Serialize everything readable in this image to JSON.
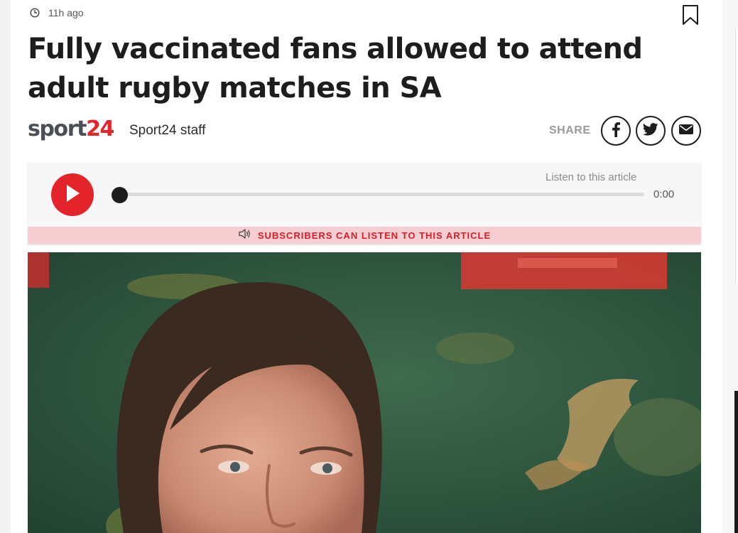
{
  "article": {
    "timestamp": "11h ago",
    "headline": "Fully vaccinated fans allowed to attend adult rugby matches in SA",
    "brand": {
      "word": "sport",
      "number": "24"
    },
    "author": "Sport24 staff",
    "share": {
      "label": "SHARE",
      "buttons": [
        "facebook-icon",
        "twitter-icon",
        "email-icon"
      ]
    }
  },
  "player": {
    "listen_label": "Listen to this article",
    "time": "0:00",
    "progress": 0,
    "subscribers_text": "SUBSCRIBERS CAN LISTEN TO THIS ARTICLE"
  },
  "colors": {
    "accent_red": "#e3242b",
    "subscriber_bar": "#f6cdd0",
    "headline_text": "#1d1d1d"
  }
}
